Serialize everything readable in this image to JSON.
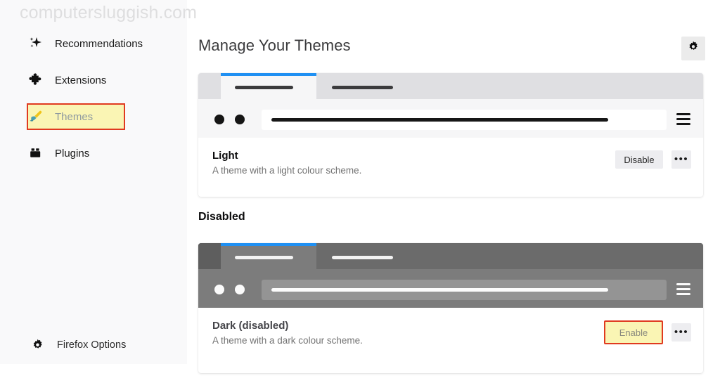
{
  "watermark": "computersluggish.com",
  "sidebar": {
    "items": [
      {
        "label": "Recommendations",
        "icon": "sparkle-icon"
      },
      {
        "label": "Extensions",
        "icon": "puzzle-piece-icon"
      },
      {
        "label": "Themes",
        "icon": "paintbrush-icon"
      },
      {
        "label": "Plugins",
        "icon": "plugin-block-icon"
      }
    ],
    "footer": {
      "label": "Firefox Options",
      "icon": "gear-icon"
    }
  },
  "main": {
    "title": "Manage Your Themes",
    "settings_icon": "gear-icon",
    "section_heading": "Disabled",
    "cards": [
      {
        "name": "Light",
        "description": "A theme with a light colour scheme.",
        "action_label": "Disable",
        "more_label": "•••",
        "preview_style": "light"
      },
      {
        "name": "Dark (disabled)",
        "description": "A theme with a dark colour scheme.",
        "action_label": "Enable",
        "more_label": "•••",
        "preview_style": "dark"
      }
    ]
  },
  "colors": {
    "accent_blue": "#1f90f3",
    "highlight_yellow": "#faf5b4",
    "highlight_border_red": "#e03a20",
    "sidebar_bg": "#f9f9fa",
    "button_gray": "#ededf0"
  }
}
